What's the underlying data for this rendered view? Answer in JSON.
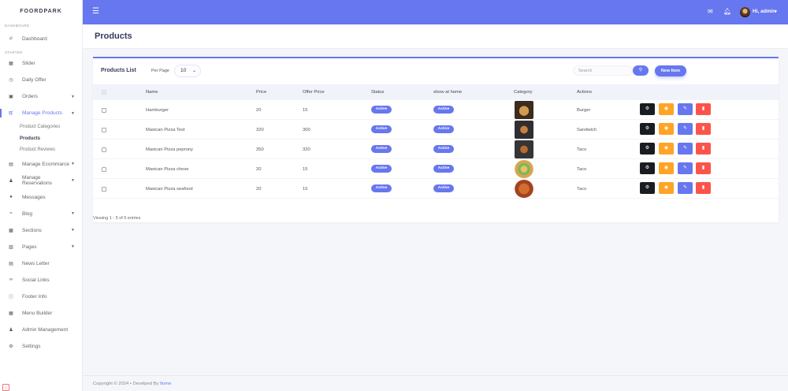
{
  "brand": "FOORDPARK",
  "sidebar": {
    "section_dashboard": "DASHBOARD",
    "section_starter": "STARTER",
    "dashboard": {
      "icon": "fire-icon",
      "label": "Dashboard"
    },
    "items": [
      {
        "icon": "image-icon",
        "label": "Slider",
        "caret": false
      },
      {
        "icon": "clock-icon",
        "label": "Daily Offer",
        "caret": false
      },
      {
        "icon": "box-icon",
        "label": "Orders",
        "caret": true
      },
      {
        "icon": "cart-icon",
        "label": "Manage Products",
        "caret": true,
        "active": true
      },
      {
        "icon": "store-icon",
        "label": "Manage Ecommarce",
        "caret": true
      },
      {
        "icon": "users-icon",
        "label": "Manage Reservations",
        "caret": true
      },
      {
        "icon": "message-icon",
        "label": "Messages",
        "caret": false
      },
      {
        "icon": "rss-icon",
        "label": "Blog",
        "caret": true
      },
      {
        "icon": "sections-icon",
        "label": "Sections",
        "caret": true
      },
      {
        "icon": "file-icon",
        "label": "Pages",
        "caret": true
      },
      {
        "icon": "newsletter-icon",
        "label": "News Letter",
        "caret": false
      },
      {
        "icon": "link-icon",
        "label": "Social Links",
        "caret": false
      },
      {
        "icon": "info-icon",
        "label": "Footer Info",
        "caret": false
      },
      {
        "icon": "menu-icon",
        "label": "Menu Builder",
        "caret": false
      },
      {
        "icon": "user-cog-icon",
        "label": "Admin Management",
        "caret": false
      },
      {
        "icon": "cogs-icon",
        "label": "Settings",
        "caret": false
      }
    ],
    "subitems": [
      "Product Categories",
      "Products",
      "Product Reviews"
    ]
  },
  "topbar": {
    "greeting": "Hi, admin"
  },
  "page": {
    "title": "Products"
  },
  "card": {
    "title": "Products List",
    "per_page_label": "Per Page",
    "per_page_value": "10",
    "search_placeholder": "Search",
    "new_button": "New Item",
    "viewing": "Viewing 1 - 5 of 5 entries"
  },
  "table": {
    "headers": [
      "Name",
      "Price",
      "Offer Price",
      "Status",
      "show at home",
      "Category",
      "Actions"
    ],
    "rows": [
      {
        "name": "Hamburger",
        "price": "20",
        "offer": "15",
        "status": "Active",
        "home": "Active",
        "category": "Burger",
        "thumb": "t1"
      },
      {
        "name": "Maxican Pizza Test",
        "price": "320",
        "offer": "300",
        "status": "Active",
        "home": "Active",
        "category": "Sandwich",
        "thumb": "t2"
      },
      {
        "name": "Maxican Pizza peprony",
        "price": "350",
        "offer": "320",
        "status": "Active",
        "home": "Active",
        "category": "Taco",
        "thumb": "t3"
      },
      {
        "name": "Maxican Pizza chese",
        "price": "20",
        "offer": "15",
        "status": "Active",
        "home": "Active",
        "category": "Taco",
        "thumb": "t4"
      },
      {
        "name": "Maxican Pizza seafood",
        "price": "20",
        "offer": "15",
        "status": "Active",
        "home": "Active",
        "category": "Taco",
        "thumb": "t5"
      }
    ]
  },
  "footer": {
    "text": "Copyright © 2024 •  Develped By ",
    "author": "Itome"
  },
  "colors": {
    "primary": "#6777ef",
    "dark": "#191d21",
    "warning": "#ffa426",
    "danger": "#fc544b"
  }
}
